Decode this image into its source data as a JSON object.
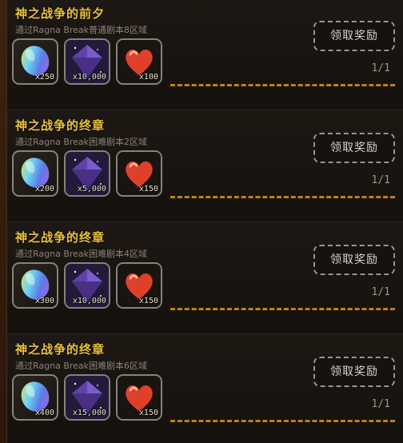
{
  "missions": [
    {
      "title": "神之战争的前夕",
      "subtitle": "通过Ragna Break普通剧本8区域",
      "rewards": [
        {
          "icon": "rainbow-crystal-icon",
          "qty": "x250"
        },
        {
          "icon": "dark-gem-icon",
          "qty": "x10,000"
        },
        {
          "icon": "heart-icon",
          "qty": "x100"
        }
      ],
      "claim_label": "领取奖励",
      "progress": "1/1"
    },
    {
      "title": "神之战争的终章",
      "subtitle": "通过Ragna Break困难剧本2区域",
      "rewards": [
        {
          "icon": "rainbow-crystal-icon",
          "qty": "x200"
        },
        {
          "icon": "dark-gem-icon",
          "qty": "x5,000"
        },
        {
          "icon": "heart-icon",
          "qty": "x150"
        }
      ],
      "claim_label": "领取奖励",
      "progress": "1/1"
    },
    {
      "title": "神之战争的终章",
      "subtitle": "通过Ragna Break困难剧本4区域",
      "rewards": [
        {
          "icon": "rainbow-crystal-icon",
          "qty": "x300"
        },
        {
          "icon": "dark-gem-icon",
          "qty": "x10,000"
        },
        {
          "icon": "heart-icon",
          "qty": "x150"
        }
      ],
      "claim_label": "领取奖励",
      "progress": "1/1"
    },
    {
      "title": "神之战争的终章",
      "subtitle": "通过Ragna Break困难剧本6区域",
      "rewards": [
        {
          "icon": "rainbow-crystal-icon",
          "qty": "x400"
        },
        {
          "icon": "dark-gem-icon",
          "qty": "x15,000"
        },
        {
          "icon": "heart-icon",
          "qty": "x150"
        }
      ],
      "claim_label": "领取奖励",
      "progress": "1/1"
    }
  ]
}
